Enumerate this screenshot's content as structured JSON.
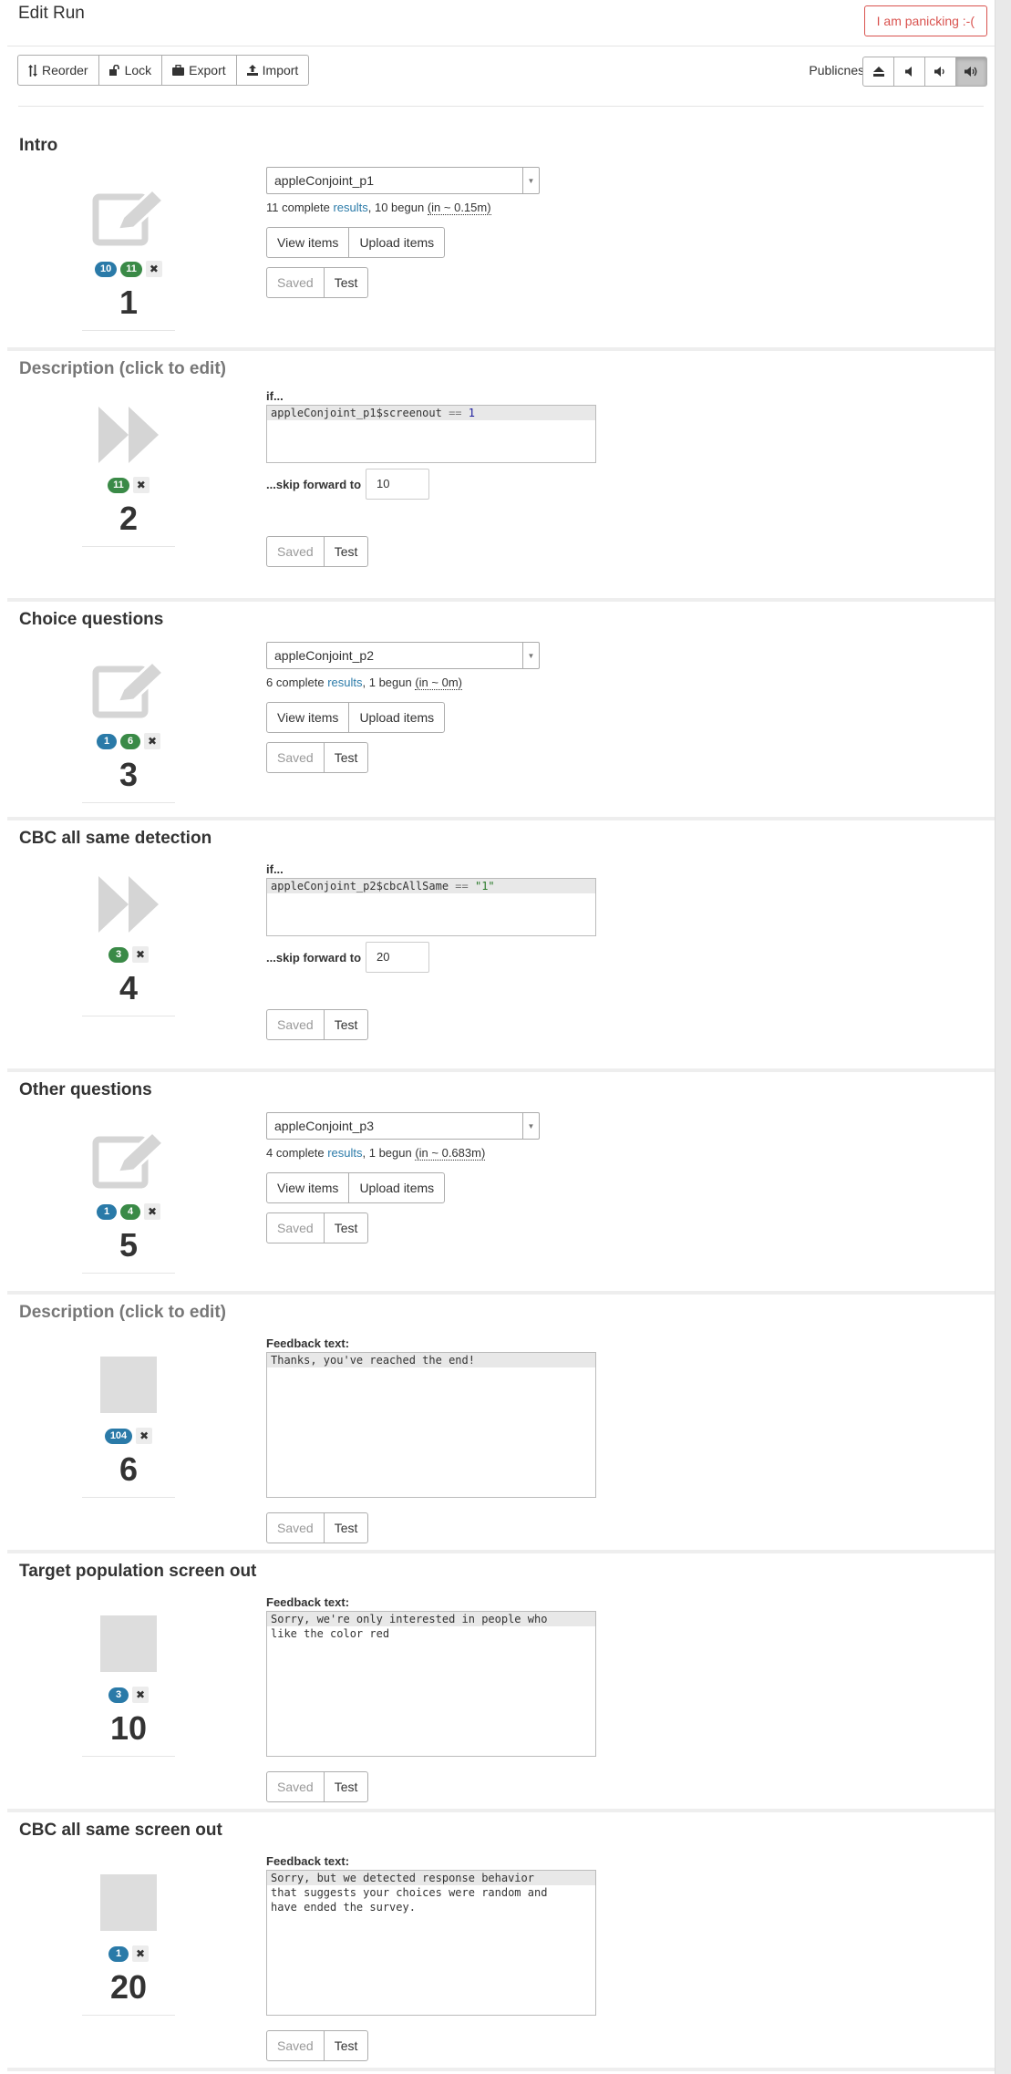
{
  "header": {
    "title": "Edit Run",
    "panic_label": "I am panicking :-(",
    "toolbar": {
      "reorder": "Reorder",
      "lock": "Lock",
      "export": "Export",
      "import": "Import"
    },
    "publicness_label": "Publicness:",
    "publicness_options": [
      "eject-icon",
      "volume-off-icon",
      "volume-down-icon",
      "volume-up-icon"
    ],
    "publicness_selected": 3
  },
  "buttons": {
    "view_items": "View items",
    "upload_items": "Upload items",
    "saved": "Saved",
    "test": "Test"
  },
  "labels": {
    "if": "if...",
    "skip_forward": "...skip forward to",
    "feedback_text": "Feedback text:"
  },
  "units": [
    {
      "title": "Intro",
      "type": "survey",
      "survey": "appleConjoint_p1",
      "stats": {
        "complete": "11 complete ",
        "results": "results",
        "begun": ", 10 begun ",
        "time": "(in ~ 0.15m)"
      },
      "badges": [
        {
          "v": "10",
          "c": "blue"
        },
        {
          "v": "11",
          "c": "green"
        }
      ],
      "position": "1"
    },
    {
      "title": "Description (click to edit)",
      "type": "skip",
      "condition": {
        "var": "appleConjoint_p1$screenout",
        "op": " == ",
        "val": "1"
      },
      "skip_to": "10",
      "badges": [
        {
          "v": "11",
          "c": "green"
        }
      ],
      "position": "2"
    },
    {
      "title": "Choice questions",
      "type": "survey",
      "survey": "appleConjoint_p2",
      "stats": {
        "complete": "6 complete ",
        "results": "results",
        "begun": ", 1 begun ",
        "time": "(in ~ 0m)"
      },
      "badges": [
        {
          "v": "1",
          "c": "blue"
        },
        {
          "v": "6",
          "c": "green"
        }
      ],
      "position": "3"
    },
    {
      "title": "CBC all same detection",
      "type": "skip",
      "condition": {
        "var": "appleConjoint_p2$cbcAllSame",
        "op": " == ",
        "val": "\"1\""
      },
      "skip_to": "20",
      "badges": [
        {
          "v": "3",
          "c": "green"
        }
      ],
      "position": "4"
    },
    {
      "title": "Other questions",
      "type": "survey",
      "survey": "appleConjoint_p3",
      "stats": {
        "complete": "4 complete ",
        "results": "results",
        "begun": ", 1 begun ",
        "time": "(in ~ 0.683m)"
      },
      "badges": [
        {
          "v": "1",
          "c": "blue"
        },
        {
          "v": "4",
          "c": "green"
        }
      ],
      "position": "5"
    },
    {
      "title": "Description (click to edit)",
      "type": "stop",
      "feedback": [
        "Thanks, you've reached the end!"
      ],
      "badges": [
        {
          "v": "104",
          "c": "blue"
        }
      ],
      "position": "6"
    },
    {
      "title": "Target population screen out",
      "type": "stop",
      "feedback": [
        "Sorry, we're only interested in people who",
        "like the color red"
      ],
      "badges": [
        {
          "v": "3",
          "c": "blue"
        }
      ],
      "position": "10"
    },
    {
      "title": "CBC all same screen out",
      "type": "stop",
      "feedback": [
        "Sorry, but we detected response behavior",
        "that suggests your choices were random and",
        "have ended the survey."
      ],
      "badges": [
        {
          "v": "1",
          "c": "blue"
        }
      ],
      "position": "20"
    }
  ]
}
